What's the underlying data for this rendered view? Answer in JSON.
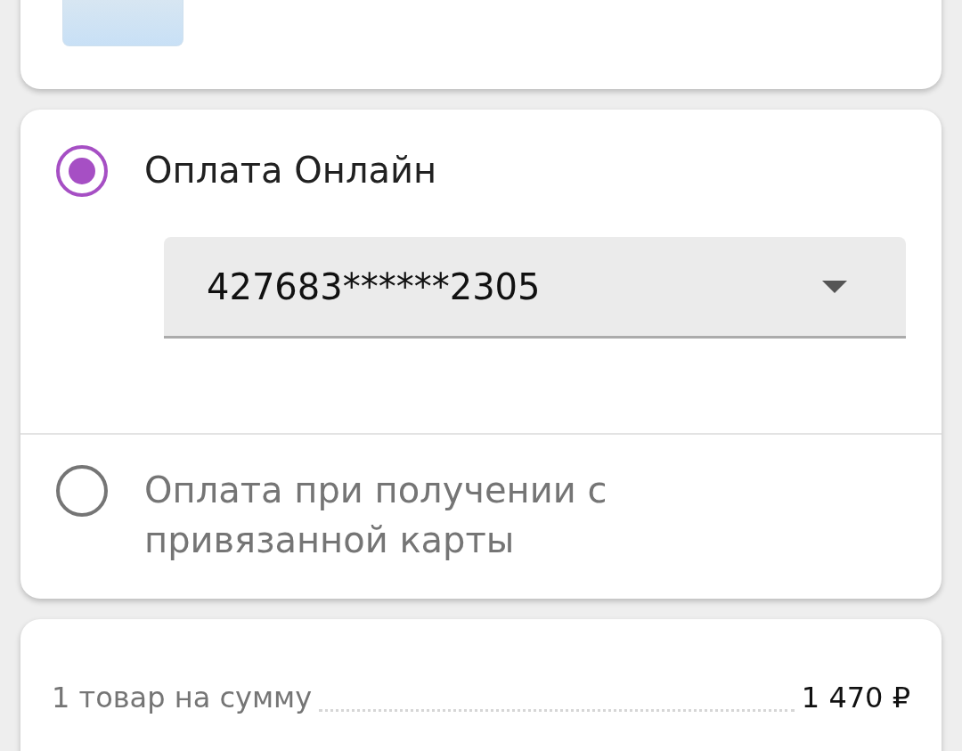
{
  "payment_options": [
    {
      "label": "Оплата Онлайн",
      "selected": true,
      "card_select": {
        "value": "427683******2305"
      }
    },
    {
      "label": "Оплата при получении с привязанной карты",
      "selected": false
    }
  ],
  "summary": {
    "rows": [
      {
        "label": "1 товар на сумму",
        "value": "1 470 ₽"
      }
    ]
  }
}
